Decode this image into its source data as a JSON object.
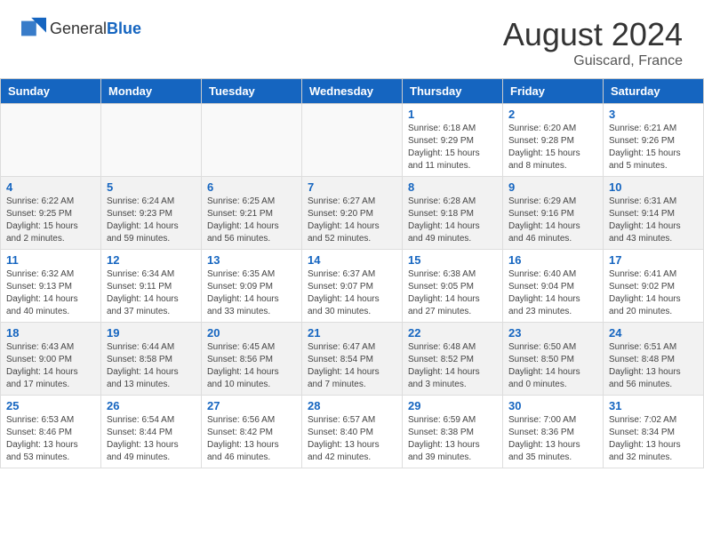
{
  "header": {
    "logo_general": "General",
    "logo_blue": "Blue",
    "month_title": "August 2024",
    "location": "Guiscard, France"
  },
  "days_of_week": [
    "Sunday",
    "Monday",
    "Tuesday",
    "Wednesday",
    "Thursday",
    "Friday",
    "Saturday"
  ],
  "weeks": [
    {
      "days": [
        {
          "num": "",
          "info": ""
        },
        {
          "num": "",
          "info": ""
        },
        {
          "num": "",
          "info": ""
        },
        {
          "num": "",
          "info": ""
        },
        {
          "num": "1",
          "info": "Sunrise: 6:18 AM\nSunset: 9:29 PM\nDaylight: 15 hours\nand 11 minutes."
        },
        {
          "num": "2",
          "info": "Sunrise: 6:20 AM\nSunset: 9:28 PM\nDaylight: 15 hours\nand 8 minutes."
        },
        {
          "num": "3",
          "info": "Sunrise: 6:21 AM\nSunset: 9:26 PM\nDaylight: 15 hours\nand 5 minutes."
        }
      ]
    },
    {
      "days": [
        {
          "num": "4",
          "info": "Sunrise: 6:22 AM\nSunset: 9:25 PM\nDaylight: 15 hours\nand 2 minutes."
        },
        {
          "num": "5",
          "info": "Sunrise: 6:24 AM\nSunset: 9:23 PM\nDaylight: 14 hours\nand 59 minutes."
        },
        {
          "num": "6",
          "info": "Sunrise: 6:25 AM\nSunset: 9:21 PM\nDaylight: 14 hours\nand 56 minutes."
        },
        {
          "num": "7",
          "info": "Sunrise: 6:27 AM\nSunset: 9:20 PM\nDaylight: 14 hours\nand 52 minutes."
        },
        {
          "num": "8",
          "info": "Sunrise: 6:28 AM\nSunset: 9:18 PM\nDaylight: 14 hours\nand 49 minutes."
        },
        {
          "num": "9",
          "info": "Sunrise: 6:29 AM\nSunset: 9:16 PM\nDaylight: 14 hours\nand 46 minutes."
        },
        {
          "num": "10",
          "info": "Sunrise: 6:31 AM\nSunset: 9:14 PM\nDaylight: 14 hours\nand 43 minutes."
        }
      ]
    },
    {
      "days": [
        {
          "num": "11",
          "info": "Sunrise: 6:32 AM\nSunset: 9:13 PM\nDaylight: 14 hours\nand 40 minutes."
        },
        {
          "num": "12",
          "info": "Sunrise: 6:34 AM\nSunset: 9:11 PM\nDaylight: 14 hours\nand 37 minutes."
        },
        {
          "num": "13",
          "info": "Sunrise: 6:35 AM\nSunset: 9:09 PM\nDaylight: 14 hours\nand 33 minutes."
        },
        {
          "num": "14",
          "info": "Sunrise: 6:37 AM\nSunset: 9:07 PM\nDaylight: 14 hours\nand 30 minutes."
        },
        {
          "num": "15",
          "info": "Sunrise: 6:38 AM\nSunset: 9:05 PM\nDaylight: 14 hours\nand 27 minutes."
        },
        {
          "num": "16",
          "info": "Sunrise: 6:40 AM\nSunset: 9:04 PM\nDaylight: 14 hours\nand 23 minutes."
        },
        {
          "num": "17",
          "info": "Sunrise: 6:41 AM\nSunset: 9:02 PM\nDaylight: 14 hours\nand 20 minutes."
        }
      ]
    },
    {
      "days": [
        {
          "num": "18",
          "info": "Sunrise: 6:43 AM\nSunset: 9:00 PM\nDaylight: 14 hours\nand 17 minutes."
        },
        {
          "num": "19",
          "info": "Sunrise: 6:44 AM\nSunset: 8:58 PM\nDaylight: 14 hours\nand 13 minutes."
        },
        {
          "num": "20",
          "info": "Sunrise: 6:45 AM\nSunset: 8:56 PM\nDaylight: 14 hours\nand 10 minutes."
        },
        {
          "num": "21",
          "info": "Sunrise: 6:47 AM\nSunset: 8:54 PM\nDaylight: 14 hours\nand 7 minutes."
        },
        {
          "num": "22",
          "info": "Sunrise: 6:48 AM\nSunset: 8:52 PM\nDaylight: 14 hours\nand 3 minutes."
        },
        {
          "num": "23",
          "info": "Sunrise: 6:50 AM\nSunset: 8:50 PM\nDaylight: 14 hours\nand 0 minutes."
        },
        {
          "num": "24",
          "info": "Sunrise: 6:51 AM\nSunset: 8:48 PM\nDaylight: 13 hours\nand 56 minutes."
        }
      ]
    },
    {
      "days": [
        {
          "num": "25",
          "info": "Sunrise: 6:53 AM\nSunset: 8:46 PM\nDaylight: 13 hours\nand 53 minutes."
        },
        {
          "num": "26",
          "info": "Sunrise: 6:54 AM\nSunset: 8:44 PM\nDaylight: 13 hours\nand 49 minutes."
        },
        {
          "num": "27",
          "info": "Sunrise: 6:56 AM\nSunset: 8:42 PM\nDaylight: 13 hours\nand 46 minutes."
        },
        {
          "num": "28",
          "info": "Sunrise: 6:57 AM\nSunset: 8:40 PM\nDaylight: 13 hours\nand 42 minutes."
        },
        {
          "num": "29",
          "info": "Sunrise: 6:59 AM\nSunset: 8:38 PM\nDaylight: 13 hours\nand 39 minutes."
        },
        {
          "num": "30",
          "info": "Sunrise: 7:00 AM\nSunset: 8:36 PM\nDaylight: 13 hours\nand 35 minutes."
        },
        {
          "num": "31",
          "info": "Sunrise: 7:02 AM\nSunset: 8:34 PM\nDaylight: 13 hours\nand 32 minutes."
        }
      ]
    }
  ]
}
